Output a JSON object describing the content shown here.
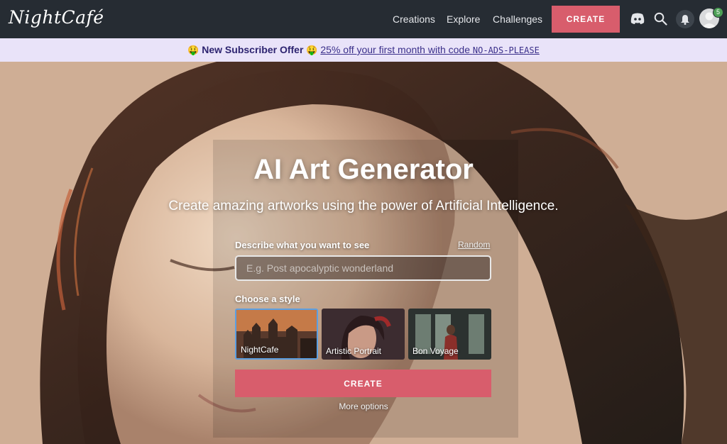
{
  "nav": {
    "logo": "NightCafé",
    "links": [
      "Creations",
      "Explore",
      "Challenges"
    ],
    "create_label": "CREATE",
    "notification_count": "5"
  },
  "promo": {
    "emoji": "🤑",
    "offer": "New Subscriber Offer",
    "link_text": "25% off your first month with code",
    "code": "NO-ADS-PLEASE"
  },
  "hero": {
    "title": "AI Art Generator",
    "subtitle": "Create amazing artworks using the power of Artificial Intelligence.",
    "prompt_label": "Describe what you want to see",
    "random_label": "Random",
    "prompt_placeholder": "E.g. Post apocalyptic wonderland",
    "prompt_value": "",
    "style_label": "Choose a style",
    "styles": [
      {
        "name": "NightCafe",
        "selected": true
      },
      {
        "name": "Artistic Portrait",
        "selected": false
      },
      {
        "name": "Bon Voyage",
        "selected": false
      }
    ],
    "create_label": "CREATE",
    "more_options": "More options"
  },
  "colors": {
    "accent": "#d85d6c",
    "nav_bg": "#262c33",
    "promo_bg": "#e9e3f9",
    "promo_text": "#3a2f8a",
    "selected_border": "#5b9fe2",
    "badge": "#4c9f55"
  },
  "icons": [
    "discord-icon",
    "search-icon",
    "bell-icon",
    "avatar"
  ]
}
